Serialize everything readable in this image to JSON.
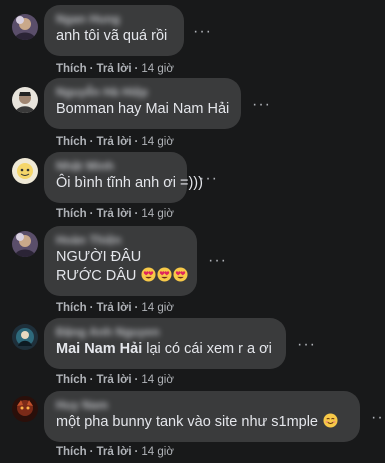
{
  "comments": [
    {
      "name": "Ngan Hung",
      "lines": [
        "anh tôi vã quá rồi"
      ],
      "like": "Thích",
      "reply": "Trả lời",
      "time": "14 giờ",
      "dot": "·"
    },
    {
      "name": "Nguyễn Hà Hiệp",
      "lines": [
        "Bomman hay Mai Nam Hải"
      ],
      "like": "Thích",
      "reply": "Trả lời",
      "time": "14 giờ",
      "dot": "·"
    },
    {
      "name": "Nhật Minh",
      "lines": [
        "Ôi bình tĩnh anh ơi =)))"
      ],
      "like": "Thích",
      "reply": "Trả lời",
      "time": "14 giờ",
      "dot": "·"
    },
    {
      "name": "Hoàn Thiện",
      "lines": [
        "NGƯỜI ĐÂU",
        "RƯỚC DÂU"
      ],
      "emojis": [
        "heart-eyes-emoji",
        "heart-eyes-emoji",
        "heart-eyes-emoji"
      ],
      "like": "Thích",
      "reply": "Trả lời",
      "time": "14 giờ",
      "dot": "·"
    },
    {
      "name": "Đặng Anh Nguyen",
      "mention": "Mai Nam Hải",
      "lines": [
        " lại có cái xem r a ơi"
      ],
      "like": "Thích",
      "reply": "Trả lời",
      "time": "14 giờ",
      "dot": "·"
    },
    {
      "name": "Huy Nam",
      "lines": [
        "một pha bunny tank vào site như s1mple"
      ],
      "emojis": [
        "smile-emoji"
      ],
      "like": "Thích",
      "reply": "Trả lời",
      "time": "14 giờ",
      "dot": "·"
    }
  ],
  "more_label": "···",
  "colors": {
    "background": "#18191a",
    "bubble": "#3a3b3c",
    "text": "#e4e6eb",
    "secondary": "#b0b3b8"
  }
}
